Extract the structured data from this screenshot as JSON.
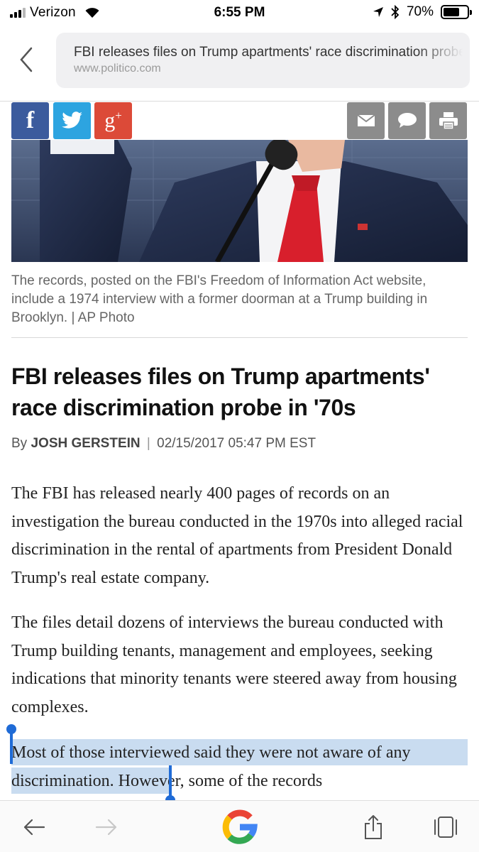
{
  "status_bar": {
    "carrier": "Verizon",
    "time": "6:55 PM",
    "battery_percent": "70%",
    "battery_level": 0.7,
    "icons": [
      "signal-icon",
      "wifi-icon",
      "location-arrow-icon",
      "bluetooth-icon",
      "battery-icon"
    ]
  },
  "browser": {
    "page_title": "FBI releases files on Trump apartments' race discrimination probe in '70s",
    "domain": "www.politico.com"
  },
  "share_buttons": {
    "facebook": "f",
    "google_plus": "g",
    "google_plus_sup": "+",
    "icons": [
      "facebook-icon",
      "twitter-icon",
      "google-plus-icon",
      "mail-icon",
      "comment-icon",
      "print-icon"
    ]
  },
  "article": {
    "caption": "The records, posted on the FBI's Freedom of Information Act website, include a 1974 interview with a former doorman at a Trump building in Brooklyn. | AP Photo",
    "headline": "FBI releases files on Trump apartments' race discrimination probe in '70s",
    "byline_prefix": "By",
    "author": "JOSH GERSTEIN",
    "byline_separator": "|",
    "date": "02/15/2017 05:47 PM EST",
    "paragraphs": [
      "The FBI has released nearly 400 pages of records on an investigation the bureau conducted in the 1970s into alleged racial discrimination in the rental of apartments from President Donald Trump's real estate company.",
      "The files detail dozens of interviews the bureau conducted with Trump building tenants, management and employees, seeking indications that minority tenants were steered away from housing complexes."
    ],
    "paragraph_3_selected": "Most of those interviewed said they were not aware of any discrimination.",
    "paragraph_3_rest": " However, some of the records"
  },
  "toolbar": {
    "icons": [
      "back-arrow-icon",
      "forward-arrow-icon",
      "google-icon",
      "share-icon",
      "tabs-icon"
    ],
    "colors": {
      "google_blue": "#4285F4",
      "google_red": "#EA4335",
      "google_yellow": "#FBBC05",
      "google_green": "#34A853"
    }
  }
}
